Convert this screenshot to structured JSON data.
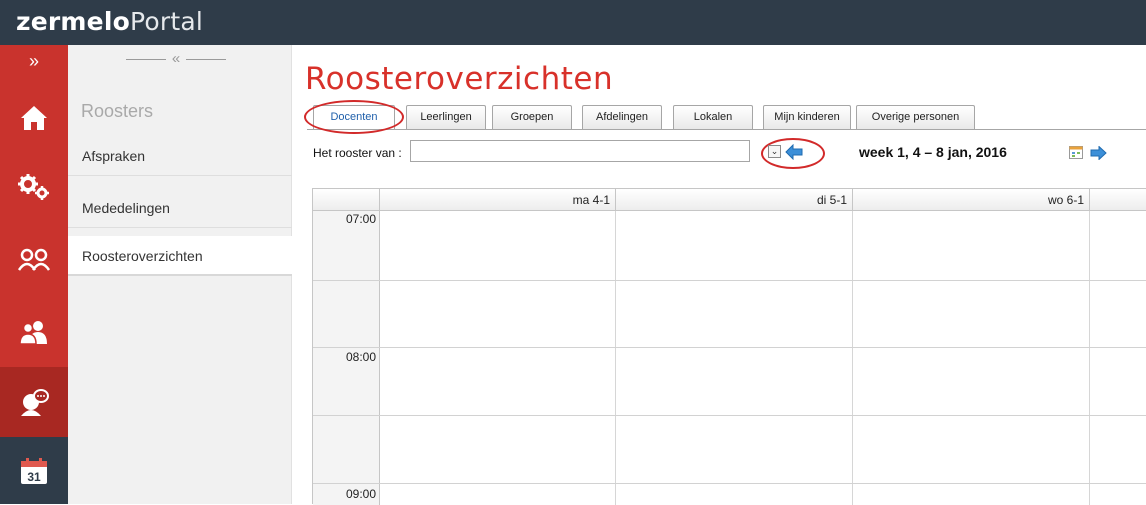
{
  "brand": {
    "part1": "zermelo",
    "part2": "Portal"
  },
  "rail": {
    "expand": "»",
    "items": [
      "home-icon",
      "gears-icon",
      "people-icon",
      "group-icon",
      "chat-icon",
      "calendar-icon"
    ],
    "calendar_day": "31"
  },
  "subside": {
    "collapse": "«",
    "title": "Roosters",
    "items": [
      {
        "label": "Afspraken"
      },
      {
        "label": "Mededelingen"
      },
      {
        "label": "Roosteroverzichten"
      }
    ]
  },
  "main": {
    "title": "Roosteroverzichten",
    "tabs": [
      {
        "label": "Docenten"
      },
      {
        "label": "Leerlingen"
      },
      {
        "label": "Groepen"
      },
      {
        "label": "Afdelingen"
      },
      {
        "label": "Lokalen"
      },
      {
        "label": "Mijn kinderen"
      },
      {
        "label": "Overige personen"
      }
    ],
    "rooster_label": "Het rooster van :",
    "rooster_value": "",
    "week_label": "week 1,  4 – 8 jan,  2016",
    "days": [
      "ma 4-1",
      "di 5-1",
      "wo 6-1"
    ],
    "times": [
      "07:00",
      "08:00",
      "09:00"
    ]
  },
  "colors": {
    "topbar": "#2f3c49",
    "rail": "#c9332d",
    "accent_title": "#d8312a",
    "active_tab_text": "#1f5faa",
    "annotation": "#d22a2a"
  }
}
